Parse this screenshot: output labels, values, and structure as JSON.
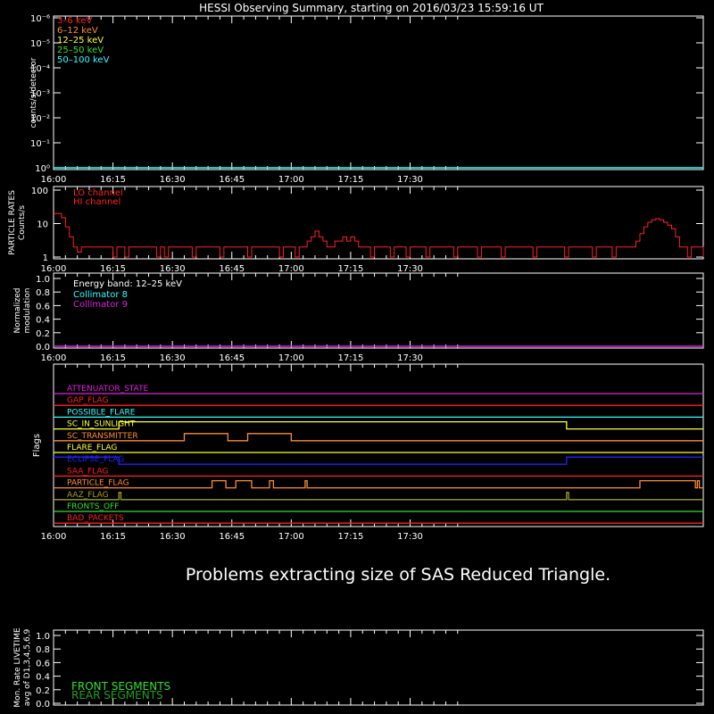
{
  "title": "HESSI Observing Summary, starting on 2016/03/23 15:59:16 UT",
  "message": "Problems extracting size of SAS Reduced Triangle.",
  "colors": {
    "background": "#000000",
    "axes": "#ffffff",
    "red": "#ff2020",
    "orange": "#ff8c30",
    "yellow": "#ffff30",
    "green": "#30e030",
    "cyan": "#30ffff",
    "magenta": "#e020e0",
    "blue": "#2020ff",
    "olive": "#a0a020",
    "darkgreen": "#20a020"
  },
  "time_ticks": [
    "16:00",
    "16:15",
    "16:30",
    "16:45",
    "17:00",
    "17:15",
    "17:30"
  ],
  "chart_data": [
    {
      "id": "count_rates",
      "type": "line",
      "ylabel": "counts/s/detector",
      "yscale": "log",
      "ylim": [
        1,
        100000
      ],
      "y_tick_labels": [
        "10⁰",
        "10⁻¹",
        "10⁻²",
        "10⁻³",
        "10⁻⁴",
        "10⁻⁵",
        "10⁻⁶"
      ],
      "legend_placement": "top-left",
      "series": [
        {
          "name": "3–6 keV",
          "color": "#ff2020"
        },
        {
          "name": "6–12 keV",
          "color": "#ff8c30"
        },
        {
          "name": "12–25 keV",
          "color": "#ffff30"
        },
        {
          "name": "25–50 keV",
          "color": "#30e030"
        },
        {
          "name": "50–100 keV",
          "color": "#30ffff"
        }
      ],
      "baseline": {
        "x_minutes": [
          0,
          164
        ],
        "y": 1,
        "color": "#30ffff"
      }
    },
    {
      "id": "particle_rates",
      "type": "line",
      "ylabel": "PARTICLE RATES Counts/s",
      "yscale": "log",
      "ylim": [
        1,
        100
      ],
      "y_tick_labels": [
        "100",
        "10",
        "1"
      ],
      "legend_placement": "top-left",
      "series": [
        {
          "name": "LO channel",
          "color": "#ff2020"
        },
        {
          "name": "HI channel",
          "color": "#ff2020"
        }
      ],
      "points": [
        [
          0,
          20
        ],
        [
          1,
          20
        ],
        [
          2,
          15
        ],
        [
          3,
          8
        ],
        [
          4,
          4
        ],
        [
          5,
          2
        ],
        [
          6,
          1.4
        ],
        [
          7,
          2
        ],
        [
          14,
          2
        ],
        [
          15,
          1
        ],
        [
          16,
          2
        ],
        [
          18,
          1
        ],
        [
          19,
          2
        ],
        [
          25,
          2
        ],
        [
          26,
          1
        ],
        [
          27,
          2
        ],
        [
          28,
          1
        ],
        [
          29,
          2
        ],
        [
          34,
          2
        ],
        [
          35,
          1
        ],
        [
          36,
          2
        ],
        [
          41,
          2
        ],
        [
          42,
          1
        ],
        [
          43,
          2
        ],
        [
          48,
          2
        ],
        [
          49,
          1
        ],
        [
          50,
          2
        ],
        [
          56,
          2
        ],
        [
          57,
          1
        ],
        [
          58,
          2
        ],
        [
          60,
          2
        ],
        [
          61,
          1
        ],
        [
          62,
          2
        ],
        [
          63,
          2
        ],
        [
          64,
          3
        ],
        [
          65,
          4
        ],
        [
          66,
          6
        ],
        [
          67,
          4
        ],
        [
          68,
          3
        ],
        [
          69,
          2
        ],
        [
          70,
          2
        ],
        [
          71,
          3
        ],
        [
          72,
          3
        ],
        [
          73,
          4
        ],
        [
          74,
          3
        ],
        [
          75,
          4
        ],
        [
          76,
          3
        ],
        [
          77,
          2
        ],
        [
          79,
          2
        ],
        [
          80,
          1
        ],
        [
          81,
          2
        ],
        [
          84,
          2
        ],
        [
          85,
          1
        ],
        [
          86,
          2
        ],
        [
          88,
          2
        ],
        [
          89,
          1
        ],
        [
          90,
          2
        ],
        [
          93,
          2
        ],
        [
          94,
          1
        ],
        [
          95,
          2
        ],
        [
          100,
          2
        ],
        [
          101,
          1
        ],
        [
          102,
          2
        ],
        [
          106,
          2
        ],
        [
          107,
          1
        ],
        [
          108,
          2
        ],
        [
          112,
          2
        ],
        [
          113,
          1
        ],
        [
          114,
          2
        ],
        [
          120,
          2
        ],
        [
          121,
          1
        ],
        [
          122,
          2
        ],
        [
          128,
          2
        ],
        [
          129,
          1
        ],
        [
          130,
          2
        ],
        [
          135,
          2
        ],
        [
          136,
          1
        ],
        [
          137,
          2
        ],
        [
          140,
          2
        ],
        [
          141,
          1
        ],
        [
          142,
          2
        ],
        [
          146,
          2
        ],
        [
          147,
          3
        ],
        [
          148,
          5
        ],
        [
          149,
          8
        ],
        [
          150,
          11
        ],
        [
          151,
          13
        ],
        [
          152,
          14
        ],
        [
          153,
          13
        ],
        [
          154,
          11
        ],
        [
          155,
          9
        ],
        [
          156,
          7
        ],
        [
          157,
          4
        ],
        [
          158,
          2
        ],
        [
          159,
          2
        ],
        [
          160,
          1
        ],
        [
          161,
          2
        ],
        [
          163,
          2
        ],
        [
          164,
          1
        ]
      ]
    },
    {
      "id": "modulation",
      "type": "line",
      "ylabel": "Normalized modulation",
      "ylim": [
        0,
        1
      ],
      "y_tick_labels": [
        "1.0",
        "0.8",
        "0.6",
        "0.4",
        "0.2",
        "0.0"
      ],
      "legend_placement": "top-left",
      "annotation": "Energy band: 12–25 keV",
      "series": [
        {
          "name": "Collimator 8",
          "color": "#30ffff"
        },
        {
          "name": "Collimator 9",
          "color": "#e020e0"
        }
      ],
      "baseline": {
        "x_minutes": [
          0,
          164
        ],
        "y": 0,
        "color": "#e020e0"
      }
    },
    {
      "id": "flags",
      "type": "line",
      "ylabel": "Flags",
      "flags": [
        {
          "name": "ATTENUATOR_STATE",
          "color": "#e020e0",
          "steps": []
        },
        {
          "name": "GAP_FLAG",
          "color": "#ff2020",
          "steps": []
        },
        {
          "name": "POSSIBLE_FLARE",
          "color": "#30ffff",
          "steps": []
        },
        {
          "name": "SC_IN_SUNLIGHT",
          "color": "#ffff30",
          "steps": [
            [
              0,
              0
            ],
            [
              16.5,
              1
            ],
            [
              129.5,
              0
            ]
          ]
        },
        {
          "name": "SC_TRANSMITTER",
          "color": "#ff8c30",
          "steps": [
            [
              0,
              0
            ],
            [
              33,
              1
            ],
            [
              44,
              0
            ],
            [
              49,
              1
            ],
            [
              60,
              0
            ]
          ]
        },
        {
          "name": "FLARE_FLAG",
          "color": "#ffff30",
          "steps": []
        },
        {
          "name": "ECLIPSE_FLAG",
          "color": "#2020ff",
          "steps": [
            [
              0,
              1
            ],
            [
              16.5,
              0
            ],
            [
              129.5,
              1
            ]
          ]
        },
        {
          "name": "SAA_FLAG",
          "color": "#ff2020",
          "steps": []
        },
        {
          "name": "PARTICLE_FLAG",
          "color": "#ff8c30",
          "steps": [
            [
              0,
              0
            ],
            [
              40,
              1
            ],
            [
              43.5,
              0
            ],
            [
              46,
              1
            ],
            [
              50,
              0
            ],
            [
              54.5,
              1
            ],
            [
              55.5,
              0
            ],
            [
              63.5,
              1
            ],
            [
              64,
              0
            ],
            [
              148,
              1
            ],
            [
              162,
              0
            ],
            [
              162.5,
              1
            ],
            [
              163,
              0
            ]
          ]
        },
        {
          "name": "AAZ_FLAG",
          "color": "#a0a020",
          "steps": [
            [
              0,
              0
            ],
            [
              16.5,
              1
            ],
            [
              17,
              0
            ],
            [
              129.5,
              1
            ],
            [
              130,
              0
            ]
          ]
        },
        {
          "name": "FRONTS_OFF",
          "color": "#30e030",
          "steps": []
        },
        {
          "name": "BAD_PACKETS",
          "color": "#ff2020",
          "steps": []
        }
      ]
    },
    {
      "id": "livetime",
      "type": "line",
      "ylabel": "Mon. Rate LIVETIME avg of D1,3,4,5,6,9",
      "ylim": [
        0,
        1
      ],
      "y_tick_labels": [
        "1.0",
        "0.8",
        "0.6",
        "0.4",
        "0.2",
        "0.0"
      ],
      "legend_placement": "bottom-left",
      "series": [
        {
          "name": "FRONT SEGMENTS",
          "color": "#30e030"
        },
        {
          "name": "REAR SEGMENTS",
          "color": "#20a020"
        }
      ]
    }
  ]
}
